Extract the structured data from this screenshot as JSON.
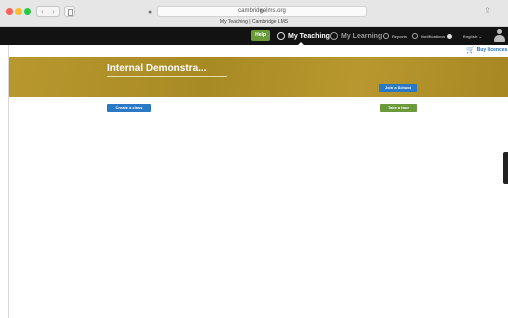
{
  "browser": {
    "address": "cambridgelms.org",
    "tab_title": "My Teaching | Cambridge LMS",
    "nav_back": "‹",
    "nav_forward": "›",
    "reload_glyph": "↻"
  },
  "navbar": {
    "help_label": "Help",
    "items": [
      {
        "label": "My Teaching",
        "icon": "teaching-icon"
      },
      {
        "label": "My Learning",
        "icon": "learning-icon"
      },
      {
        "label": "Reports",
        "icon": "reports-icon"
      },
      {
        "label": "Notifications",
        "icon": "notifications-icon"
      },
      {
        "label": "English ⌄",
        "icon": "language-icon"
      }
    ]
  },
  "buy_licences": "Buy licences",
  "banner": {
    "title": "Internal Demonstra...",
    "join_school": "Join a School"
  },
  "actions": {
    "create_class": "Create a class",
    "take_tour": "Take a tour"
  },
  "colors": {
    "navbar_bg": "#121212",
    "banner_gold": "#b8982e",
    "primary_blue": "#2a79c4",
    "green": "#6a9a3a"
  }
}
